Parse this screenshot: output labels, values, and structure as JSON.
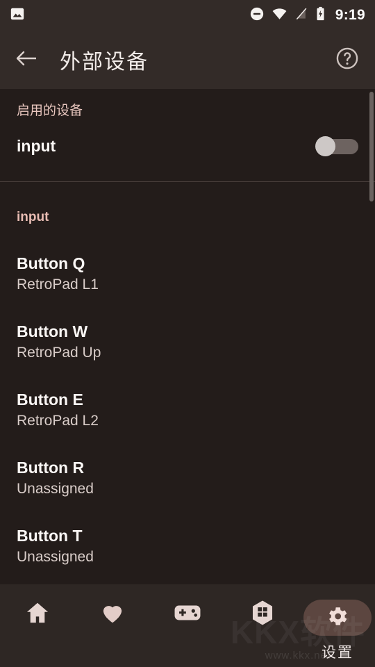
{
  "status_bar": {
    "time": "9:19",
    "icons": [
      "image-icon",
      "do-not-disturb-icon",
      "wifi-icon",
      "no-signal-icon",
      "battery-charging-icon"
    ]
  },
  "app_bar": {
    "back_icon": "back-arrow-icon",
    "title": "外部设备",
    "help_icon": "help-circle-icon"
  },
  "content": {
    "enabled_section": {
      "header": "启用的设备",
      "device": {
        "name": "input",
        "toggle_state": "off"
      }
    },
    "input_section": {
      "header": "input",
      "bindings": [
        {
          "button": "Button Q",
          "mapping": "RetroPad L1"
        },
        {
          "button": "Button W",
          "mapping": "RetroPad Up"
        },
        {
          "button": "Button E",
          "mapping": "RetroPad L2"
        },
        {
          "button": "Button R",
          "mapping": "Unassigned"
        },
        {
          "button": "Button T",
          "mapping": "Unassigned"
        }
      ]
    }
  },
  "bottom_nav": {
    "items": [
      {
        "icon": "home-icon",
        "label": "",
        "selected": false
      },
      {
        "icon": "heart-icon",
        "label": "",
        "selected": false
      },
      {
        "icon": "gamepad-icon",
        "label": "",
        "selected": false
      },
      {
        "icon": "hexagon-grid-icon",
        "label": "",
        "selected": false
      },
      {
        "icon": "gear-icon",
        "label": "设置",
        "selected": true
      }
    ]
  },
  "watermark": {
    "big": "KKX软件",
    "small": "www.kkx.net"
  },
  "colors": {
    "background": "#231c1a",
    "bar": "#332b28",
    "accent": "#e8bcb3",
    "nav_bar": "#2e2724",
    "pill": "#5c4640",
    "icon": "#e6d6d2"
  }
}
